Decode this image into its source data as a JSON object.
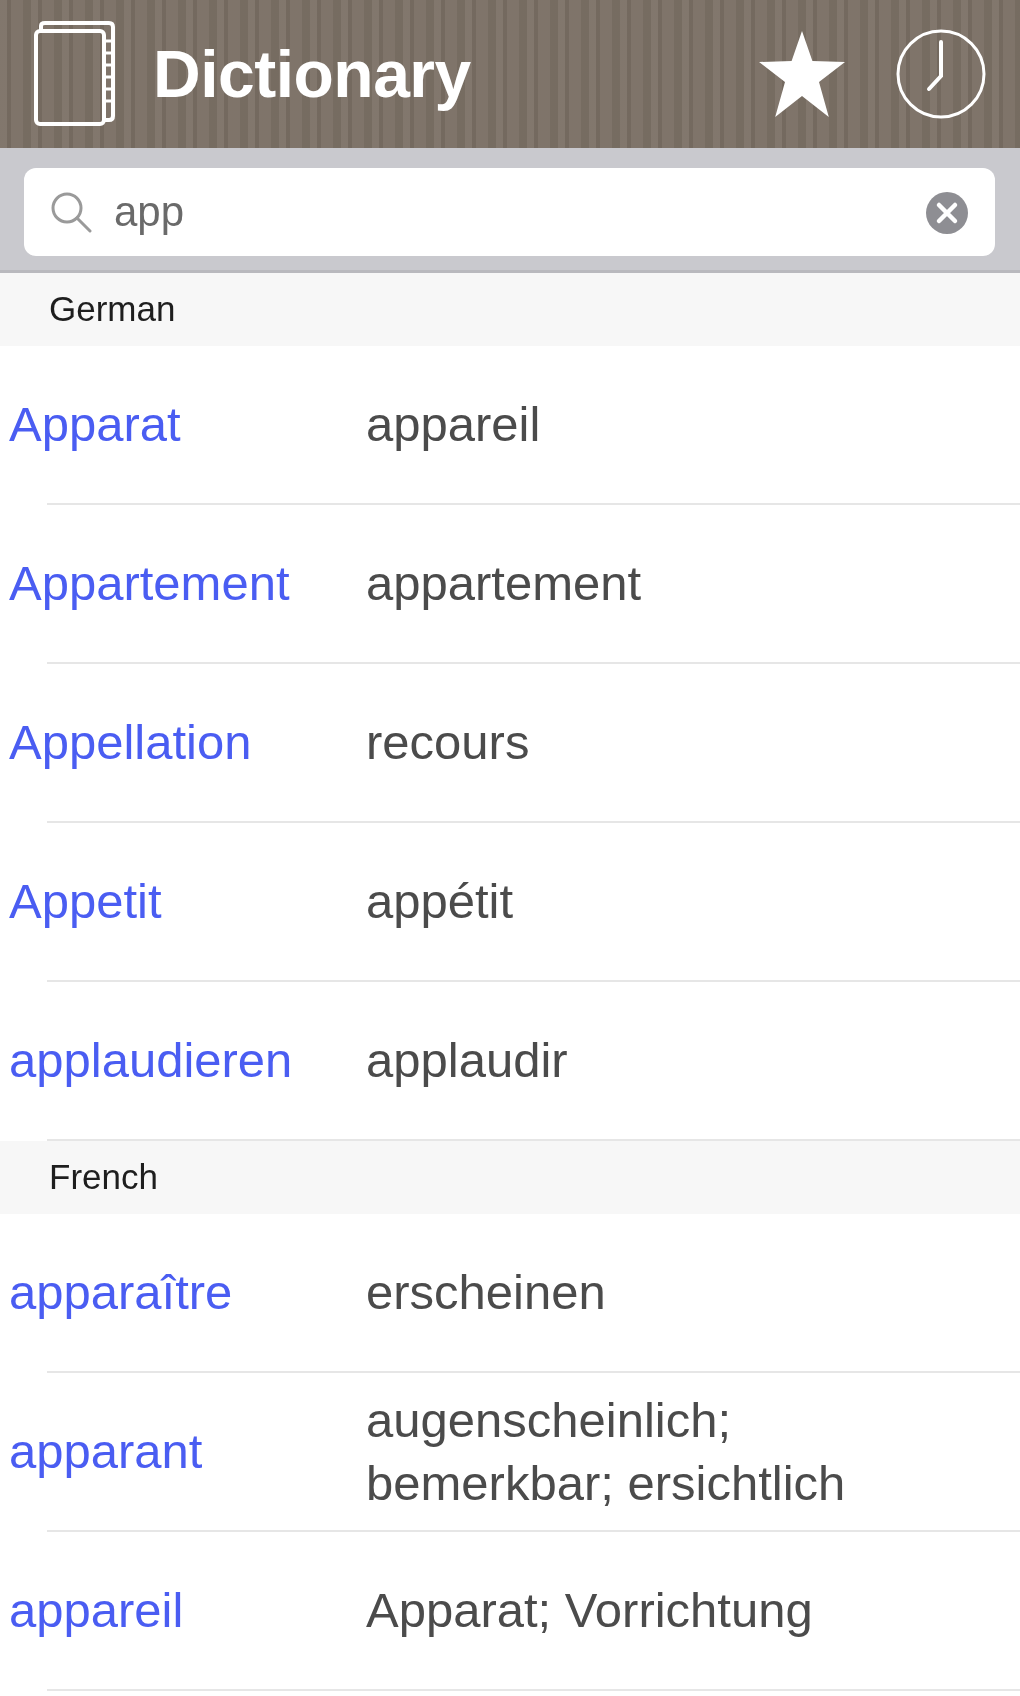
{
  "header": {
    "title": "Dictionary"
  },
  "search": {
    "value": "app"
  },
  "sections": [
    {
      "title": "German",
      "entries": [
        {
          "word": "Apparat",
          "translation": "appareil"
        },
        {
          "word": "Appartement",
          "translation": "appartement"
        },
        {
          "word": "Appellation",
          "translation": "recours"
        },
        {
          "word": "Appetit",
          "translation": "appétit"
        },
        {
          "word": "applaudieren",
          "translation": "applaudir"
        }
      ]
    },
    {
      "title": "French",
      "entries": [
        {
          "word": "apparaître",
          "translation": "erscheinen"
        },
        {
          "word": "apparant",
          "translation": "augenscheinlich; bemerkbar; ersichtlich"
        },
        {
          "word": "appareil",
          "translation": "Apparat; Vorrichtung"
        }
      ]
    }
  ]
}
